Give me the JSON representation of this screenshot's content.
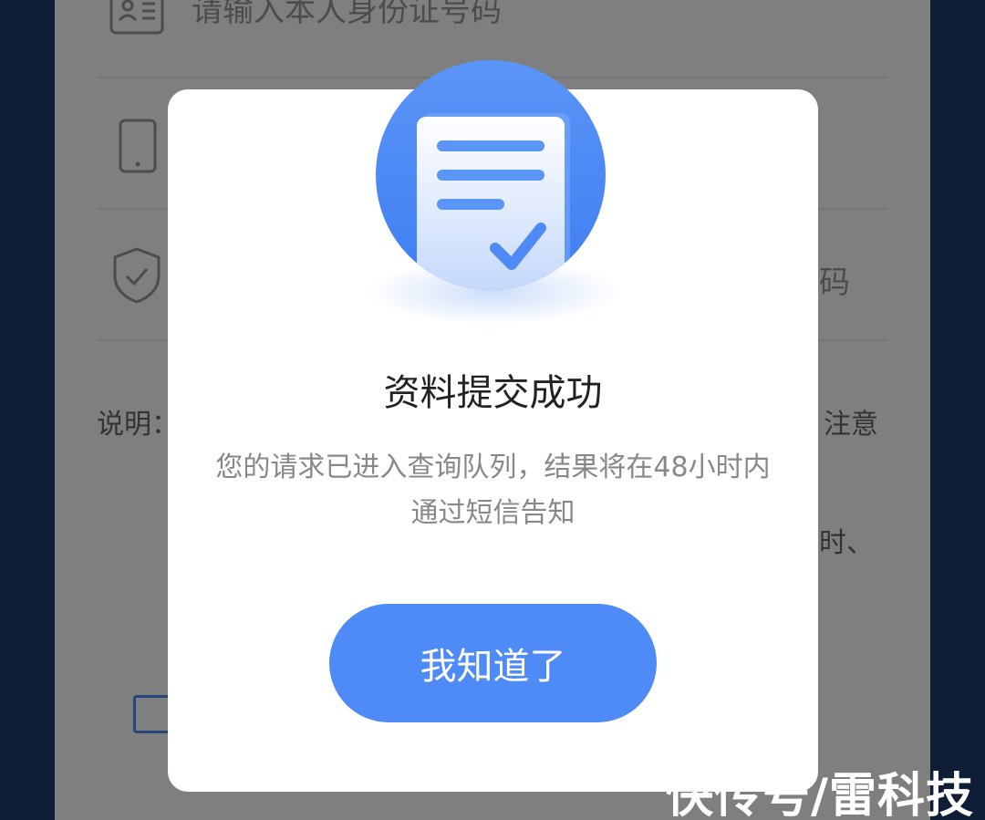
{
  "background_form": {
    "id_placeholder": "请输入本人身份证号码",
    "code_suffix": "码",
    "note_prefix": "说明：",
    "note_suffix": "注意",
    "note_suffix2": "时、"
  },
  "dialog": {
    "title": "资料提交成功",
    "description": "您的请求已进入查询队列，结果将在48小时内通过短信告知",
    "ok_button": "我知道了"
  },
  "watermark": "快传号/雷科技",
  "colors": {
    "accent": "#4f8bf6",
    "frame": "#1f3a6e"
  }
}
